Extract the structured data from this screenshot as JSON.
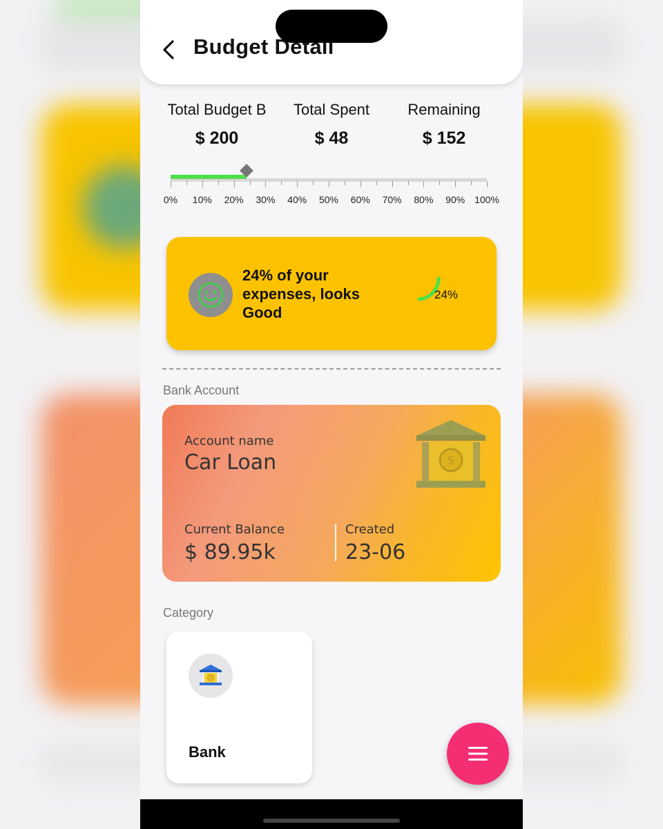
{
  "header": {
    "title": "Budget Detail",
    "back_icon": "chevron-left-icon"
  },
  "stats": [
    {
      "label": "Total Budget B",
      "value": "$ 200"
    },
    {
      "label": "Total Spent",
      "value": "$ 48"
    },
    {
      "label": "Remaining",
      "value": "$ 152"
    }
  ],
  "progress": {
    "spent_fraction": 0.24,
    "fill_color": "#4ee04a",
    "tick_labels": [
      "0%",
      "10%",
      "20%",
      "30%",
      "40%",
      "50%",
      "60%",
      "70%",
      "80%",
      "90%",
      "100%"
    ]
  },
  "status_card": {
    "message": "24% of your expenses, looks Good",
    "percent_label": "24%",
    "percent": 24,
    "icon": "smiley-face-icon",
    "accent": "#fcc200"
  },
  "bank_section": {
    "label": "Bank Account",
    "account_name_label": "Account name",
    "account_name": "Car Loan",
    "balance_label": "Current Balance",
    "balance": "$ 89.95k",
    "created_label": "Created",
    "created": "23-06",
    "icon": "bank-building-icon"
  },
  "category_section": {
    "label": "Category",
    "items": [
      {
        "name": "Bank",
        "icon": "bank-icon"
      }
    ]
  },
  "fab": {
    "icon": "menu-icon",
    "color": "#f42e72"
  }
}
